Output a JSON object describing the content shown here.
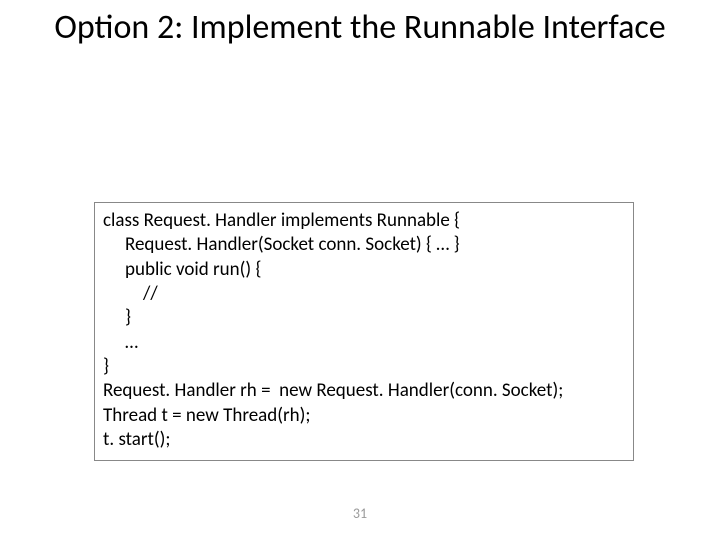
{
  "title": "Option 2: Implement the Runnable Interface",
  "code": {
    "l1": "class Request. Handler implements Runnable {",
    "l2": "Request. Handler(Socket conn. Socket) { … }",
    "l3": "public void run() {",
    "l4": "//",
    "l5": "}",
    "l6": "…",
    "l7": "}",
    "l8": "Request. Handler rh =  new Request. Handler(conn. Socket);",
    "l9": "Thread t = new Thread(rh);",
    "l10": "t. start();"
  },
  "page_number": "31"
}
